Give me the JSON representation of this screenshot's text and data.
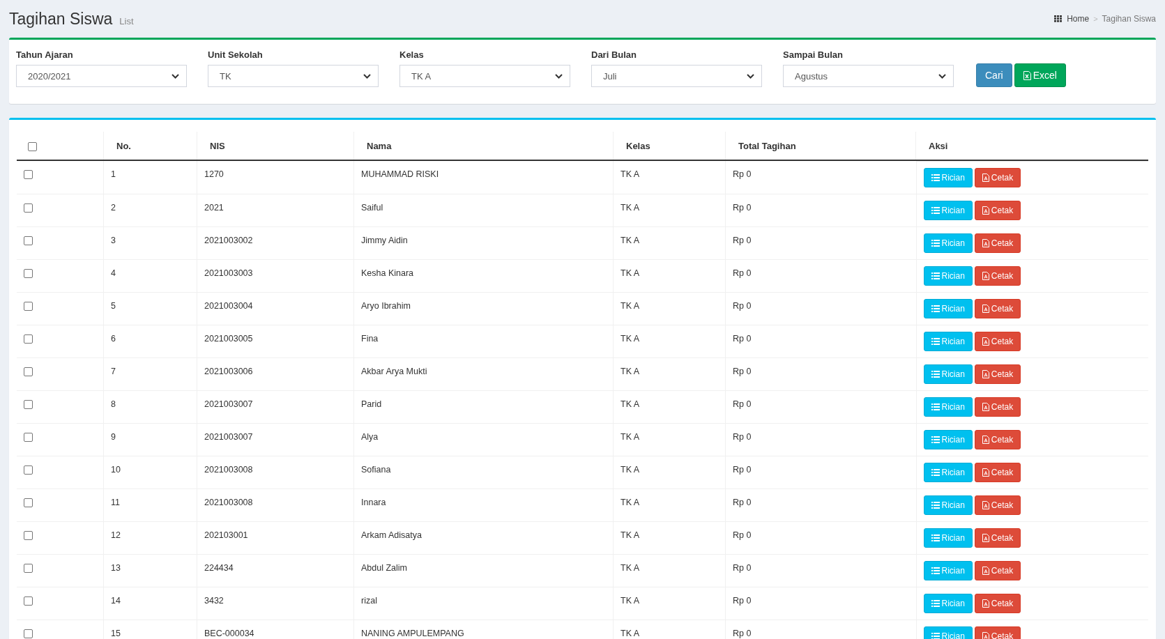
{
  "header": {
    "title": "Tagihan Siswa",
    "subtitle": "List",
    "breadcrumb": [
      {
        "label": "Home",
        "kind": "link"
      },
      {
        "label": "Tagihan Siswa",
        "kind": "current"
      }
    ],
    "separator": ">"
  },
  "filters": [
    {
      "label": "Tahun Ajaran",
      "value": "2020/2021"
    },
    {
      "label": "Unit Sekolah",
      "value": "TK"
    },
    {
      "label": "Kelas",
      "value": "TK A"
    },
    {
      "label": "Dari Bulan",
      "value": "Juli"
    },
    {
      "label": "Sampai Bulan",
      "value": "Agustus"
    }
  ],
  "buttons": [
    {
      "label": "Cari",
      "kind": "search"
    },
    {
      "label": "Excel",
      "kind": "excel"
    }
  ],
  "table": {
    "select_all": {
      "checked": false
    },
    "columns": [
      "No.",
      "NIS",
      "Nama",
      "Kelas",
      "Total Tagihan",
      "Aksi"
    ],
    "rows": [
      {
        "checked": false,
        "no": "1",
        "nis": "1270",
        "nama": "MUHAMMAD RISKI",
        "kelas": "TK A",
        "total": "Rp 0",
        "actions": [
          {
            "label": "Rician",
            "kind": "detail"
          },
          {
            "label": "Cetak",
            "kind": "print"
          }
        ]
      },
      {
        "checked": false,
        "no": "2",
        "nis": "2021",
        "nama": "Saiful",
        "kelas": "TK A",
        "total": "Rp 0",
        "actions": [
          {
            "label": "Rician",
            "kind": "detail"
          },
          {
            "label": "Cetak",
            "kind": "print"
          }
        ]
      },
      {
        "checked": false,
        "no": "3",
        "nis": "2021003002",
        "nama": "Jimmy Aidin",
        "kelas": "TK A",
        "total": "Rp 0",
        "actions": [
          {
            "label": "Rician",
            "kind": "detail"
          },
          {
            "label": "Cetak",
            "kind": "print"
          }
        ]
      },
      {
        "checked": false,
        "no": "4",
        "nis": "2021003003",
        "nama": "Kesha Kinara",
        "kelas": "TK A",
        "total": "Rp 0",
        "actions": [
          {
            "label": "Rician",
            "kind": "detail"
          },
          {
            "label": "Cetak",
            "kind": "print"
          }
        ]
      },
      {
        "checked": false,
        "no": "5",
        "nis": "2021003004",
        "nama": "Aryo Ibrahim",
        "kelas": "TK A",
        "total": "Rp 0",
        "actions": [
          {
            "label": "Rician",
            "kind": "detail"
          },
          {
            "label": "Cetak",
            "kind": "print"
          }
        ]
      },
      {
        "checked": false,
        "no": "6",
        "nis": "2021003005",
        "nama": "Fina",
        "kelas": "TK A",
        "total": "Rp 0",
        "actions": [
          {
            "label": "Rician",
            "kind": "detail"
          },
          {
            "label": "Cetak",
            "kind": "print"
          }
        ]
      },
      {
        "checked": false,
        "no": "7",
        "nis": "2021003006",
        "nama": "Akbar Arya Mukti",
        "kelas": "TK A",
        "total": "Rp 0",
        "actions": [
          {
            "label": "Rician",
            "kind": "detail"
          },
          {
            "label": "Cetak",
            "kind": "print"
          }
        ]
      },
      {
        "checked": false,
        "no": "8",
        "nis": "2021003007",
        "nama": "Parid",
        "kelas": "TK A",
        "total": "Rp 0",
        "actions": [
          {
            "label": "Rician",
            "kind": "detail"
          },
          {
            "label": "Cetak",
            "kind": "print"
          }
        ]
      },
      {
        "checked": false,
        "no": "9",
        "nis": "2021003007",
        "nama": "Alya",
        "kelas": "TK A",
        "total": "Rp 0",
        "actions": [
          {
            "label": "Rician",
            "kind": "detail"
          },
          {
            "label": "Cetak",
            "kind": "print"
          }
        ]
      },
      {
        "checked": false,
        "no": "10",
        "nis": "2021003008",
        "nama": "Sofiana",
        "kelas": "TK A",
        "total": "Rp 0",
        "actions": [
          {
            "label": "Rician",
            "kind": "detail"
          },
          {
            "label": "Cetak",
            "kind": "print"
          }
        ]
      },
      {
        "checked": false,
        "no": "11",
        "nis": "2021003008",
        "nama": "Innara",
        "kelas": "TK A",
        "total": "Rp 0",
        "actions": [
          {
            "label": "Rician",
            "kind": "detail"
          },
          {
            "label": "Cetak",
            "kind": "print"
          }
        ]
      },
      {
        "checked": false,
        "no": "12",
        "nis": "202103001",
        "nama": "Arkam Adisatya",
        "kelas": "TK A",
        "total": "Rp 0",
        "actions": [
          {
            "label": "Rician",
            "kind": "detail"
          },
          {
            "label": "Cetak",
            "kind": "print"
          }
        ]
      },
      {
        "checked": false,
        "no": "13",
        "nis": "224434",
        "nama": "Abdul Zalim",
        "kelas": "TK A",
        "total": "Rp 0",
        "actions": [
          {
            "label": "Rician",
            "kind": "detail"
          },
          {
            "label": "Cetak",
            "kind": "print"
          }
        ]
      },
      {
        "checked": false,
        "no": "14",
        "nis": "3432",
        "nama": "rizal",
        "kelas": "TK A",
        "total": "Rp 0",
        "actions": [
          {
            "label": "Rician",
            "kind": "detail"
          },
          {
            "label": "Cetak",
            "kind": "print"
          }
        ]
      },
      {
        "checked": false,
        "no": "15",
        "nis": "BEC-000034",
        "nama": "NANING AMPULEMPANG",
        "kelas": "TK A",
        "total": "Rp 0",
        "actions": [
          {
            "label": "Rician",
            "kind": "detail"
          },
          {
            "label": "Cetak",
            "kind": "print"
          }
        ]
      }
    ]
  }
}
